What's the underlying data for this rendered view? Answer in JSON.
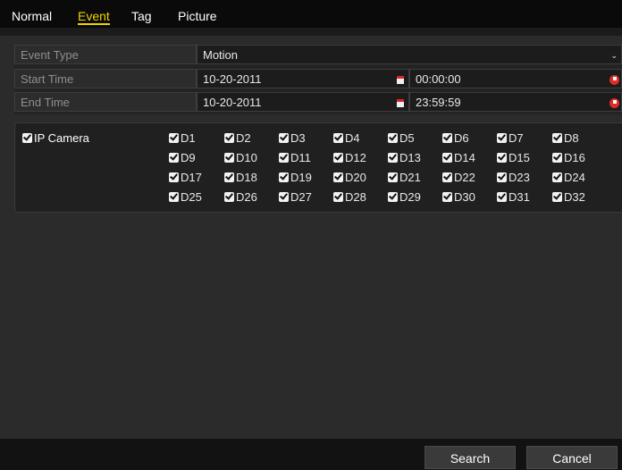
{
  "tabs": [
    {
      "label": "Normal"
    },
    {
      "label": "Event"
    },
    {
      "label": "Tag"
    },
    {
      "label": "Picture"
    }
  ],
  "active_tab": "Event",
  "params": {
    "event_type_label": "Event Type",
    "event_type_value": "Motion",
    "start_time_label": "Start Time",
    "start_date": "10-20-2011",
    "start_time": "00:00:00",
    "end_time_label": "End Time",
    "end_date": "10-20-2011",
    "end_time": "23:59:59"
  },
  "cameras": {
    "header_label": "IP Camera",
    "header_checked": true,
    "channels": [
      {
        "label": "D1",
        "checked": true
      },
      {
        "label": "D2",
        "checked": true
      },
      {
        "label": "D3",
        "checked": true
      },
      {
        "label": "D4",
        "checked": true
      },
      {
        "label": "D5",
        "checked": true
      },
      {
        "label": "D6",
        "checked": true
      },
      {
        "label": "D7",
        "checked": true
      },
      {
        "label": "D8",
        "checked": true
      },
      {
        "label": "D9",
        "checked": true
      },
      {
        "label": "D10",
        "checked": true
      },
      {
        "label": "D11",
        "checked": true
      },
      {
        "label": "D12",
        "checked": true
      },
      {
        "label": "D13",
        "checked": true
      },
      {
        "label": "D14",
        "checked": true
      },
      {
        "label": "D15",
        "checked": true
      },
      {
        "label": "D16",
        "checked": true
      },
      {
        "label": "D17",
        "checked": true
      },
      {
        "label": "D18",
        "checked": true
      },
      {
        "label": "D19",
        "checked": true
      },
      {
        "label": "D20",
        "checked": true
      },
      {
        "label": "D21",
        "checked": true
      },
      {
        "label": "D22",
        "checked": true
      },
      {
        "label": "D23",
        "checked": true
      },
      {
        "label": "D24",
        "checked": true
      },
      {
        "label": "D25",
        "checked": true
      },
      {
        "label": "D26",
        "checked": true
      },
      {
        "label": "D27",
        "checked": true
      },
      {
        "label": "D28",
        "checked": true
      },
      {
        "label": "D29",
        "checked": true
      },
      {
        "label": "D30",
        "checked": true
      },
      {
        "label": "D31",
        "checked": true
      },
      {
        "label": "D32",
        "checked": true
      }
    ]
  },
  "buttons": {
    "search_label": "Search",
    "cancel_label": "Cancel"
  },
  "colors": {
    "active_tab": "#f2d300",
    "background": "#2b2b2b",
    "icon_red": "#e02a2a"
  },
  "icons": {
    "calendar": "calendar-icon",
    "clock": "clock-icon",
    "dropdown": "chevron-down-icon",
    "checkbox": "checkbox-checked-icon"
  }
}
